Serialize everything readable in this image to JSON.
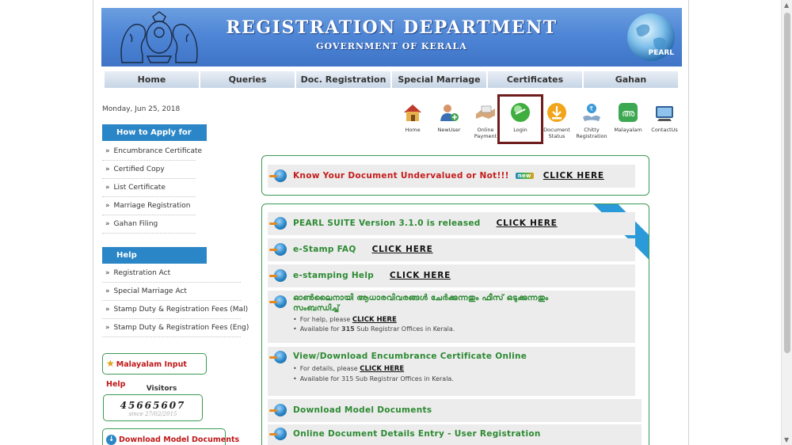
{
  "header": {
    "title": "REGISTRATION DEPARTMENT",
    "subtitle": "GOVERNMENT OF KERALA",
    "logo_text": "PEARL"
  },
  "nav": [
    "Home",
    "Queries",
    "Doc. Registration",
    "Special Marriage",
    "Certificates",
    "Gahan"
  ],
  "date": "Monday, Jun 25, 2018",
  "sidebar": {
    "how_to_apply": {
      "heading": "How to Apply for",
      "items": [
        "Encumbrance Certificate",
        "Certified Copy",
        "List Certificate",
        "Marriage Registration",
        "Gahan Filing"
      ]
    },
    "help": {
      "heading": "Help",
      "items": [
        "Registration Act",
        "Special Marriage Act",
        "Stamp Duty & Registration Fees (Mal)",
        "Stamp Duty & Registration Fees (Eng)"
      ]
    },
    "malayalam_help": "Malayalam Input Help",
    "visitors_label": "Visitors",
    "visitors_count": "45665607",
    "visitors_since": "since 27/02/2015",
    "download_models": "Download Model Documents"
  },
  "toolbar": [
    {
      "label": "Home",
      "icon": "home-icon"
    },
    {
      "label": "NewUser",
      "icon": "new-user-icon"
    },
    {
      "label": "Online Payment",
      "icon": "payment-icon"
    },
    {
      "label": "Login",
      "icon": "login-icon"
    },
    {
      "label": "Document Status",
      "icon": "document-status-icon"
    },
    {
      "label": "Chitty Registration",
      "icon": "chitty-icon"
    },
    {
      "label": "Malayalam",
      "icon": "malayalam-icon"
    },
    {
      "label": "ContactUs",
      "icon": "contact-icon"
    }
  ],
  "notice": {
    "text": "Know Your Document Undervalued or Not!!!",
    "badge": "new",
    "link": "CLICK HERE"
  },
  "links_ribbon": "Links",
  "links": [
    {
      "text": "PEARL SUITE Version 3.1.0 is released",
      "link": "CLICK HERE"
    },
    {
      "text": "e-Stamp FAQ",
      "link": "CLICK HERE"
    },
    {
      "text": "e-stamping Help",
      "link": "CLICK HERE"
    },
    {
      "text": "ഓൺലൈനായി ആധാരവിവരങ്ങൾ ചേർക്കുന്നതും ഫീസ് ഒടുക്കുന്നതും",
      "text2": "സംബന്ധിച്ച്",
      "sub1_prefix": "For help, please",
      "sub1_link": "CLICK HERE",
      "sub2_prefix": "Available for",
      "sub2_bold": "315",
      "sub2_suffix": "Sub Registrar Offices in Kerala."
    },
    {
      "text": "View/Download Encumbrance Certificate Online",
      "sub1_prefix": "For details, please",
      "sub1_link": "CLICK HERE",
      "sub2": "Available for 315 Sub Registrar Offices in Kerala."
    },
    {
      "text": "Download Model Documents"
    },
    {
      "text": "Online Document Details Entry - User Registration"
    }
  ],
  "colors": {
    "accent": "#2a86c6",
    "green": "#2d8a33",
    "red": "#c61c1c",
    "border": "#3a9a55",
    "login_highlight": "#6f1c1c"
  }
}
